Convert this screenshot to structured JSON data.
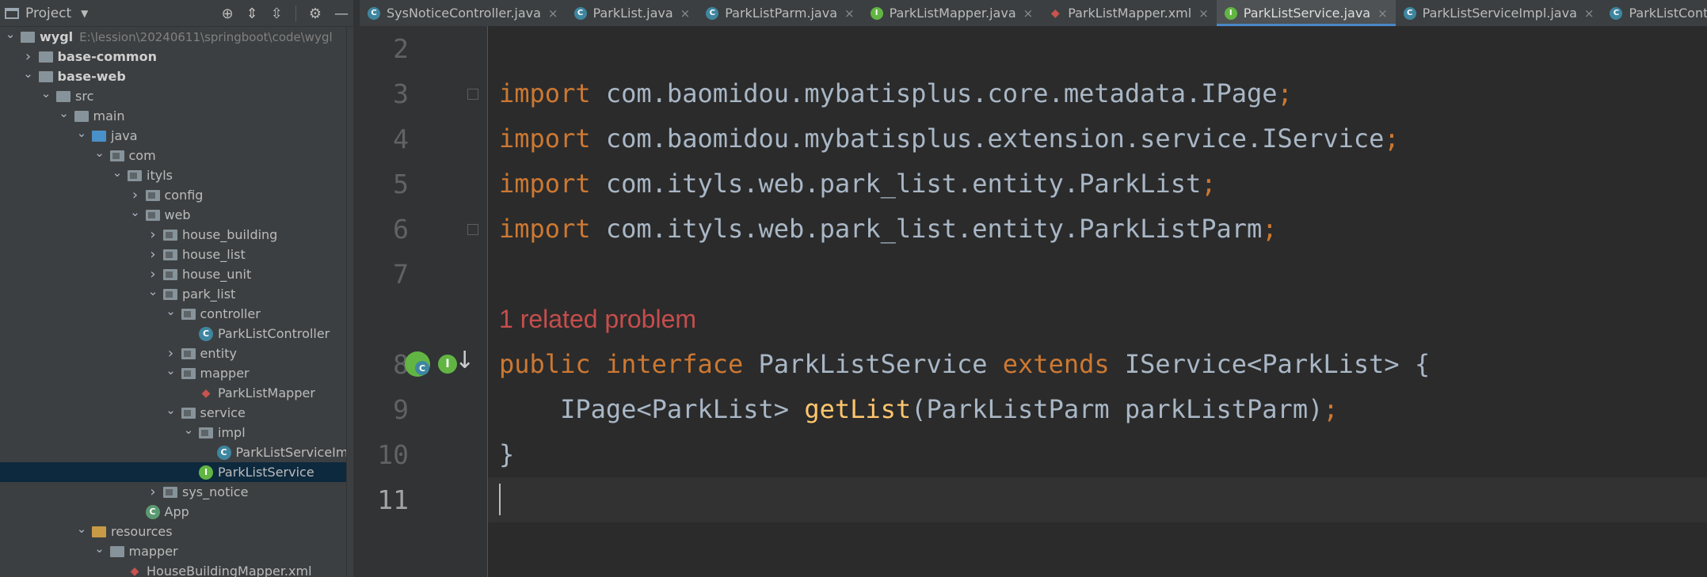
{
  "project_panel": {
    "title": "Project",
    "tree": [
      {
        "label": "wygl",
        "path": "E:\\lession\\20240611\\springboot\\code\\wygl",
        "depth": 0,
        "arrow": "open",
        "icon": "folder-module-icon",
        "bold": true
      },
      {
        "label": "base-common",
        "depth": 1,
        "arrow": "closed",
        "icon": "folder-module-icon",
        "bold": true
      },
      {
        "label": "base-web",
        "depth": 1,
        "arrow": "open",
        "icon": "folder-module-icon",
        "bold": true
      },
      {
        "label": "src",
        "depth": 2,
        "arrow": "open",
        "icon": "folder-icon"
      },
      {
        "label": "main",
        "depth": 3,
        "arrow": "open",
        "icon": "folder-icon"
      },
      {
        "label": "java",
        "depth": 4,
        "arrow": "open",
        "icon": "folder-source-icon"
      },
      {
        "label": "com",
        "depth": 5,
        "arrow": "open",
        "icon": "package-icon"
      },
      {
        "label": "ityls",
        "depth": 6,
        "arrow": "open",
        "icon": "package-icon"
      },
      {
        "label": "config",
        "depth": 7,
        "arrow": "closed",
        "icon": "package-icon"
      },
      {
        "label": "web",
        "depth": 7,
        "arrow": "open",
        "icon": "package-icon"
      },
      {
        "label": "house_building",
        "depth": 8,
        "arrow": "closed",
        "icon": "package-icon"
      },
      {
        "label": "house_list",
        "depth": 8,
        "arrow": "closed",
        "icon": "package-icon"
      },
      {
        "label": "house_unit",
        "depth": 8,
        "arrow": "closed",
        "icon": "package-icon"
      },
      {
        "label": "park_list",
        "depth": 8,
        "arrow": "open",
        "icon": "package-icon"
      },
      {
        "label": "controller",
        "depth": 9,
        "arrow": "open",
        "icon": "package-icon"
      },
      {
        "label": "ParkListController",
        "depth": 10,
        "arrow": "none",
        "icon": "class-icon"
      },
      {
        "label": "entity",
        "depth": 9,
        "arrow": "closed",
        "icon": "package-icon"
      },
      {
        "label": "mapper",
        "depth": 9,
        "arrow": "open",
        "icon": "package-icon"
      },
      {
        "label": "ParkListMapper",
        "depth": 10,
        "arrow": "none",
        "icon": "mybatis-mapper-icon"
      },
      {
        "label": "service",
        "depth": 9,
        "arrow": "open",
        "icon": "package-icon"
      },
      {
        "label": "impl",
        "depth": 10,
        "arrow": "open",
        "icon": "package-icon"
      },
      {
        "label": "ParkListServiceImpl",
        "depth": 11,
        "arrow": "none",
        "icon": "class-icon"
      },
      {
        "label": "ParkListService",
        "depth": 10,
        "arrow": "none",
        "icon": "interface-icon",
        "selected": true
      },
      {
        "label": "sys_notice",
        "depth": 8,
        "arrow": "closed",
        "icon": "package-icon"
      },
      {
        "label": "App",
        "depth": 7,
        "arrow": "none",
        "icon": "spring-app-icon"
      },
      {
        "label": "resources",
        "depth": 4,
        "arrow": "open",
        "icon": "folder-resources-icon"
      },
      {
        "label": "mapper",
        "depth": 5,
        "arrow": "open",
        "icon": "folder-icon"
      },
      {
        "label": "HouseBuildingMapper.xml",
        "depth": 6,
        "arrow": "none",
        "icon": "xml-icon"
      }
    ]
  },
  "tabs": [
    {
      "label": "SysNoticeController.java",
      "icon": "class-icon",
      "active": false
    },
    {
      "label": "ParkList.java",
      "icon": "class-icon",
      "active": false
    },
    {
      "label": "ParkListParm.java",
      "icon": "class-icon",
      "active": false
    },
    {
      "label": "ParkListMapper.java",
      "icon": "interface-icon",
      "active": false
    },
    {
      "label": "ParkListMapper.xml",
      "icon": "xml-icon",
      "active": false
    },
    {
      "label": "ParkListService.java",
      "icon": "interface-icon",
      "active": true
    },
    {
      "label": "ParkListServiceImpl.java",
      "icon": "class-icon",
      "active": false
    },
    {
      "label": "ParkListController.java",
      "icon": "class-icon",
      "active": false
    }
  ],
  "editor": {
    "lines": [
      {
        "num": "2",
        "tokens": []
      },
      {
        "num": "3",
        "tokens": [
          [
            "kw",
            "import"
          ],
          [
            "plain",
            " com.baomidou.mybatisplus.core.metadata.IPage"
          ],
          [
            "semi",
            ";"
          ]
        ],
        "fold": true
      },
      {
        "num": "4",
        "tokens": [
          [
            "kw",
            "import"
          ],
          [
            "plain",
            " com.baomidou.mybatisplus.extension.service.IService"
          ],
          [
            "semi",
            ";"
          ]
        ]
      },
      {
        "num": "5",
        "tokens": [
          [
            "kw",
            "import"
          ],
          [
            "plain",
            " com.ityls.web.park_list.entity.ParkList"
          ],
          [
            "semi",
            ";"
          ]
        ]
      },
      {
        "num": "6",
        "tokens": [
          [
            "kw",
            "import"
          ],
          [
            "plain",
            " com.ityls.web.park_list.entity.ParkListParm"
          ],
          [
            "semi",
            ";"
          ]
        ],
        "fold": true
      },
      {
        "num": "7",
        "tokens": []
      },
      {
        "num": "",
        "problem": "1 related problem"
      },
      {
        "num": "8",
        "tokens": [
          [
            "kw",
            "public interface"
          ],
          [
            "plain",
            " ParkListService "
          ],
          [
            "kw",
            "extends"
          ],
          [
            "plain",
            " IService<ParkList> {"
          ]
        ],
        "gutter_icons": true
      },
      {
        "num": "9",
        "tokens": [
          [
            "plain",
            "    IPage<ParkList> "
          ],
          [
            "fn",
            "getList"
          ],
          [
            "plain",
            "(ParkListParm parkListParm)"
          ],
          [
            "semi",
            ";"
          ]
        ]
      },
      {
        "num": "10",
        "tokens": [
          [
            "plain",
            "}"
          ]
        ]
      },
      {
        "num": "11",
        "tokens": [],
        "current": true
      }
    ]
  }
}
